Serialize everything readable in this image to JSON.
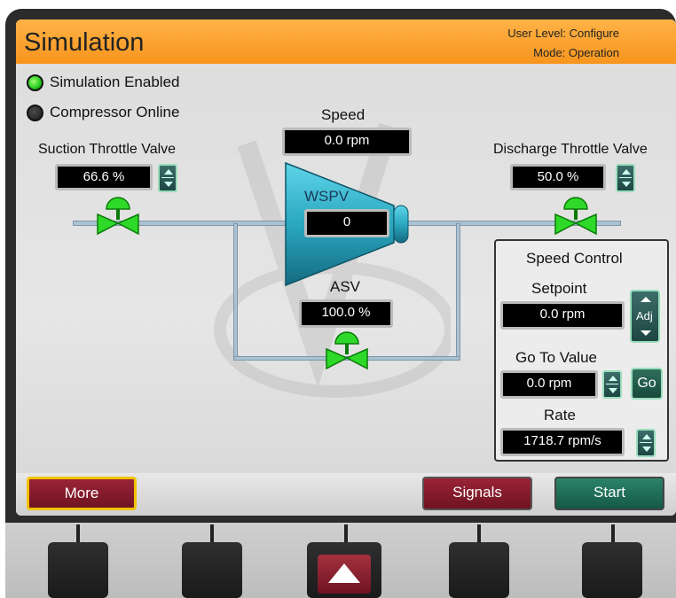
{
  "header": {
    "title": "Simulation",
    "user_level": "User Level: Configure",
    "mode": "Mode: Operation"
  },
  "status": {
    "simulation_enabled": "Simulation Enabled",
    "compressor_online": "Compressor Online"
  },
  "suction": {
    "label": "Suction Throttle Valve",
    "value": "66.6 %"
  },
  "speed": {
    "label": "Speed",
    "value": "0.0 rpm"
  },
  "discharge": {
    "label": "Discharge Throttle Valve",
    "value": "50.0 %"
  },
  "wspv": {
    "label": "WSPV",
    "value": "0"
  },
  "asv": {
    "label": "ASV",
    "value": "100.0 %"
  },
  "speed_control": {
    "title": "Speed Control",
    "setpoint_label": "Setpoint",
    "setpoint_value": "0.0 rpm",
    "adj_label": "Adj",
    "goto_label": "Go To Value",
    "goto_value": "0.0 rpm",
    "go_label": "Go",
    "rate_label": "Rate",
    "rate_value": "1718.7 rpm/s"
  },
  "footer": {
    "more": "More",
    "signals": "Signals",
    "start": "Start"
  },
  "colors": {
    "accent_orange": "#f7941d",
    "maroon_button": "#8a1a2a",
    "green_button": "#1d6a55",
    "valve_green": "#22c81c",
    "compressor_blue": "#2aa7c0"
  },
  "icons": {
    "valve": "valve-icon",
    "compressor": "compressor-icon",
    "up_arrow": "up-arrow-icon"
  }
}
